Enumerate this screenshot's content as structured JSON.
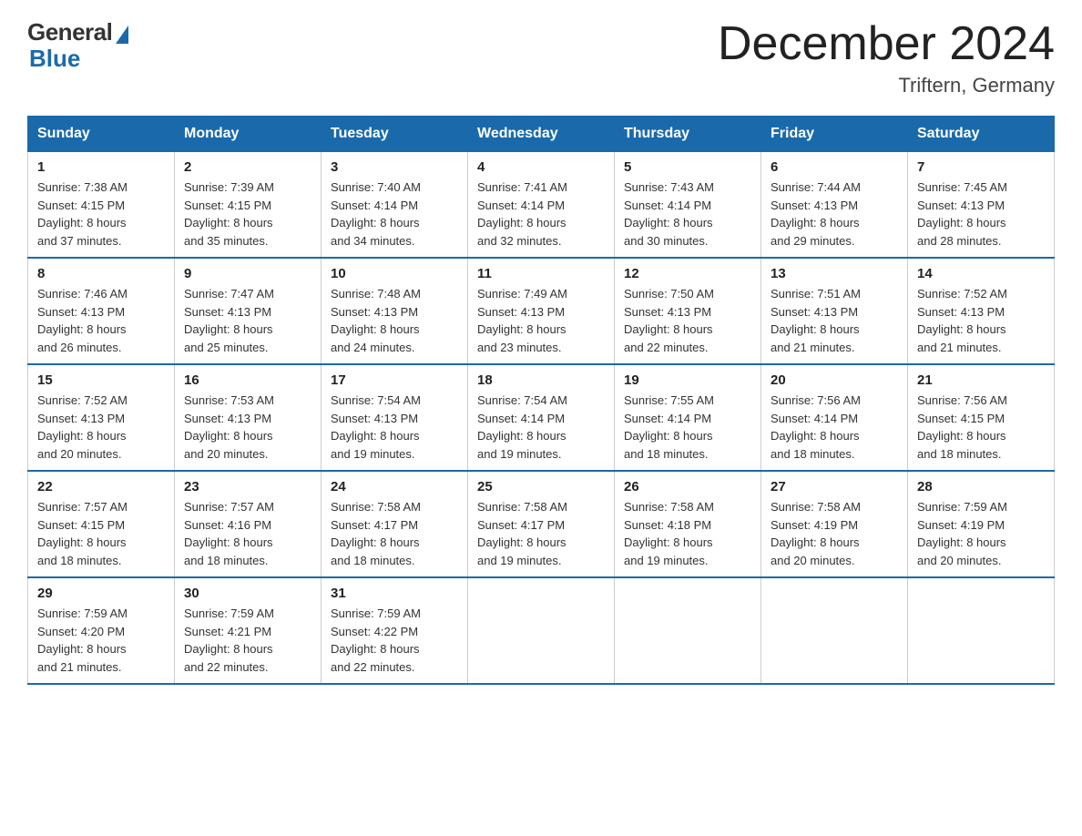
{
  "logo": {
    "general": "General",
    "blue": "Blue"
  },
  "title": "December 2024",
  "subtitle": "Triftern, Germany",
  "weekdays": [
    "Sunday",
    "Monday",
    "Tuesday",
    "Wednesday",
    "Thursday",
    "Friday",
    "Saturday"
  ],
  "weeks": [
    [
      {
        "day": "1",
        "sunrise": "7:38 AM",
        "sunset": "4:15 PM",
        "daylight": "8 hours and 37 minutes."
      },
      {
        "day": "2",
        "sunrise": "7:39 AM",
        "sunset": "4:15 PM",
        "daylight": "8 hours and 35 minutes."
      },
      {
        "day": "3",
        "sunrise": "7:40 AM",
        "sunset": "4:14 PM",
        "daylight": "8 hours and 34 minutes."
      },
      {
        "day": "4",
        "sunrise": "7:41 AM",
        "sunset": "4:14 PM",
        "daylight": "8 hours and 32 minutes."
      },
      {
        "day": "5",
        "sunrise": "7:43 AM",
        "sunset": "4:14 PM",
        "daylight": "8 hours and 30 minutes."
      },
      {
        "day": "6",
        "sunrise": "7:44 AM",
        "sunset": "4:13 PM",
        "daylight": "8 hours and 29 minutes."
      },
      {
        "day": "7",
        "sunrise": "7:45 AM",
        "sunset": "4:13 PM",
        "daylight": "8 hours and 28 minutes."
      }
    ],
    [
      {
        "day": "8",
        "sunrise": "7:46 AM",
        "sunset": "4:13 PM",
        "daylight": "8 hours and 26 minutes."
      },
      {
        "day": "9",
        "sunrise": "7:47 AM",
        "sunset": "4:13 PM",
        "daylight": "8 hours and 25 minutes."
      },
      {
        "day": "10",
        "sunrise": "7:48 AM",
        "sunset": "4:13 PM",
        "daylight": "8 hours and 24 minutes."
      },
      {
        "day": "11",
        "sunrise": "7:49 AM",
        "sunset": "4:13 PM",
        "daylight": "8 hours and 23 minutes."
      },
      {
        "day": "12",
        "sunrise": "7:50 AM",
        "sunset": "4:13 PM",
        "daylight": "8 hours and 22 minutes."
      },
      {
        "day": "13",
        "sunrise": "7:51 AM",
        "sunset": "4:13 PM",
        "daylight": "8 hours and 21 minutes."
      },
      {
        "day": "14",
        "sunrise": "7:52 AM",
        "sunset": "4:13 PM",
        "daylight": "8 hours and 21 minutes."
      }
    ],
    [
      {
        "day": "15",
        "sunrise": "7:52 AM",
        "sunset": "4:13 PM",
        "daylight": "8 hours and 20 minutes."
      },
      {
        "day": "16",
        "sunrise": "7:53 AM",
        "sunset": "4:13 PM",
        "daylight": "8 hours and 20 minutes."
      },
      {
        "day": "17",
        "sunrise": "7:54 AM",
        "sunset": "4:13 PM",
        "daylight": "8 hours and 19 minutes."
      },
      {
        "day": "18",
        "sunrise": "7:54 AM",
        "sunset": "4:14 PM",
        "daylight": "8 hours and 19 minutes."
      },
      {
        "day": "19",
        "sunrise": "7:55 AM",
        "sunset": "4:14 PM",
        "daylight": "8 hours and 18 minutes."
      },
      {
        "day": "20",
        "sunrise": "7:56 AM",
        "sunset": "4:14 PM",
        "daylight": "8 hours and 18 minutes."
      },
      {
        "day": "21",
        "sunrise": "7:56 AM",
        "sunset": "4:15 PM",
        "daylight": "8 hours and 18 minutes."
      }
    ],
    [
      {
        "day": "22",
        "sunrise": "7:57 AM",
        "sunset": "4:15 PM",
        "daylight": "8 hours and 18 minutes."
      },
      {
        "day": "23",
        "sunrise": "7:57 AM",
        "sunset": "4:16 PM",
        "daylight": "8 hours and 18 minutes."
      },
      {
        "day": "24",
        "sunrise": "7:58 AM",
        "sunset": "4:17 PM",
        "daylight": "8 hours and 18 minutes."
      },
      {
        "day": "25",
        "sunrise": "7:58 AM",
        "sunset": "4:17 PM",
        "daylight": "8 hours and 19 minutes."
      },
      {
        "day": "26",
        "sunrise": "7:58 AM",
        "sunset": "4:18 PM",
        "daylight": "8 hours and 19 minutes."
      },
      {
        "day": "27",
        "sunrise": "7:58 AM",
        "sunset": "4:19 PM",
        "daylight": "8 hours and 20 minutes."
      },
      {
        "day": "28",
        "sunrise": "7:59 AM",
        "sunset": "4:19 PM",
        "daylight": "8 hours and 20 minutes."
      }
    ],
    [
      {
        "day": "29",
        "sunrise": "7:59 AM",
        "sunset": "4:20 PM",
        "daylight": "8 hours and 21 minutes."
      },
      {
        "day": "30",
        "sunrise": "7:59 AM",
        "sunset": "4:21 PM",
        "daylight": "8 hours and 22 minutes."
      },
      {
        "day": "31",
        "sunrise": "7:59 AM",
        "sunset": "4:22 PM",
        "daylight": "8 hours and 22 minutes."
      },
      null,
      null,
      null,
      null
    ]
  ],
  "labels": {
    "sunrise": "Sunrise: ",
    "sunset": "Sunset: ",
    "daylight": "Daylight: "
  }
}
